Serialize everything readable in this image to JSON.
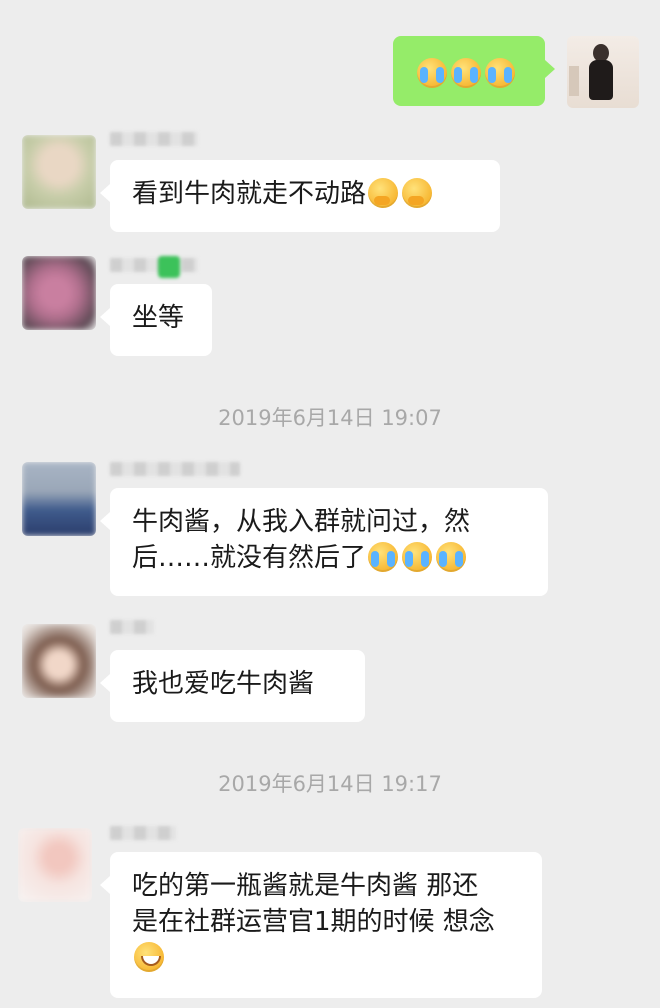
{
  "messages": {
    "m1_text": "看到牛肉就走不动路",
    "m2_text": "坐等",
    "timestamp1": "2019年6月14日 19:07",
    "m3_line1": "牛肉酱，从我入群就问过，然",
    "m3_line2": "后……就没有然后了",
    "m4_text": "我也爱吃牛肉酱",
    "timestamp2": "2019年6月14日 19:17",
    "m5_line1": "吃的第一瓶酱就是牛肉酱 那还",
    "m5_line2": "是在社群运营官1期的时候 想念"
  },
  "emojis": {
    "m0": [
      "facepalm-cry",
      "facepalm-cry",
      "facepalm-cry"
    ],
    "m1": [
      "covering-mouth-laugh",
      "covering-mouth-laugh"
    ],
    "m3": [
      "facepalm-cry",
      "facepalm-cry",
      "facepalm-cry"
    ],
    "m5": [
      "grin"
    ]
  },
  "colors": {
    "background": "#ededed",
    "bubble_self": "#95ec69",
    "bubble_other": "#ffffff",
    "timestamp": "#a8a8a8"
  }
}
